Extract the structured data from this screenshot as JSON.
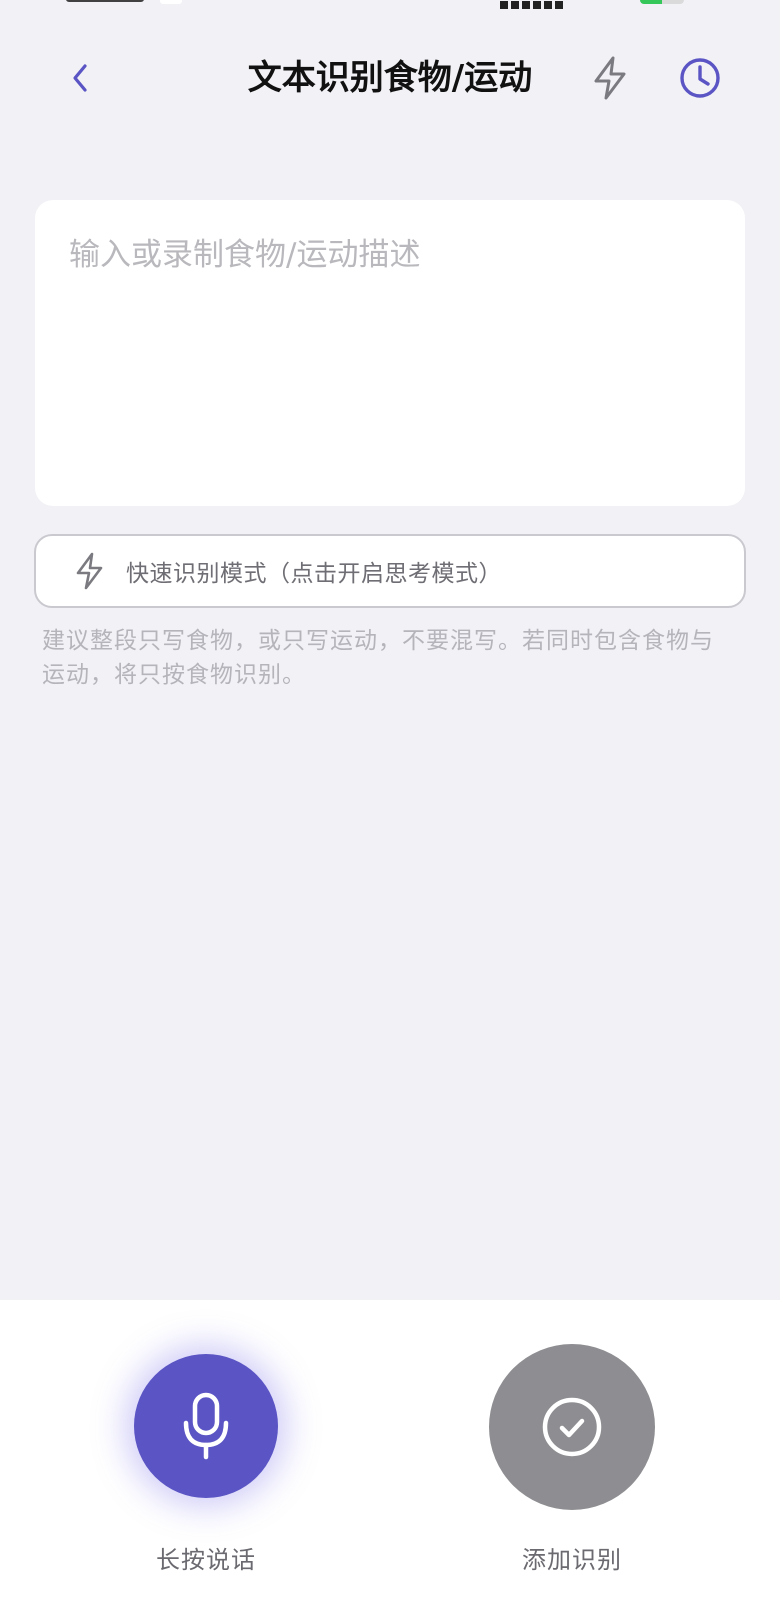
{
  "colors": {
    "accent": "#5a54c4",
    "background": "#f1f1f6",
    "card": "#ffffff",
    "disabled_button": "#8e8e92",
    "battery_fill": "#35c759"
  },
  "nav": {
    "back_icon": "chevron-left-icon",
    "title": "文本识别食物/运动",
    "flash_icon": "lightning-icon",
    "history_icon": "clock-icon"
  },
  "input": {
    "value": "",
    "placeholder": "输入或录制食物/运动描述"
  },
  "mode": {
    "icon": "lightning-icon",
    "label": "快速识别模式（点击开启思考模式）"
  },
  "hint": {
    "text": "建议整段只写食物，或只写运动，不要混写。若同时包含食物与运动，将只按食物识别。"
  },
  "actions": {
    "voice": {
      "icon": "microphone-icon",
      "label": "长按说话"
    },
    "confirm": {
      "icon": "check-circle-icon",
      "label": "添加识别"
    }
  }
}
